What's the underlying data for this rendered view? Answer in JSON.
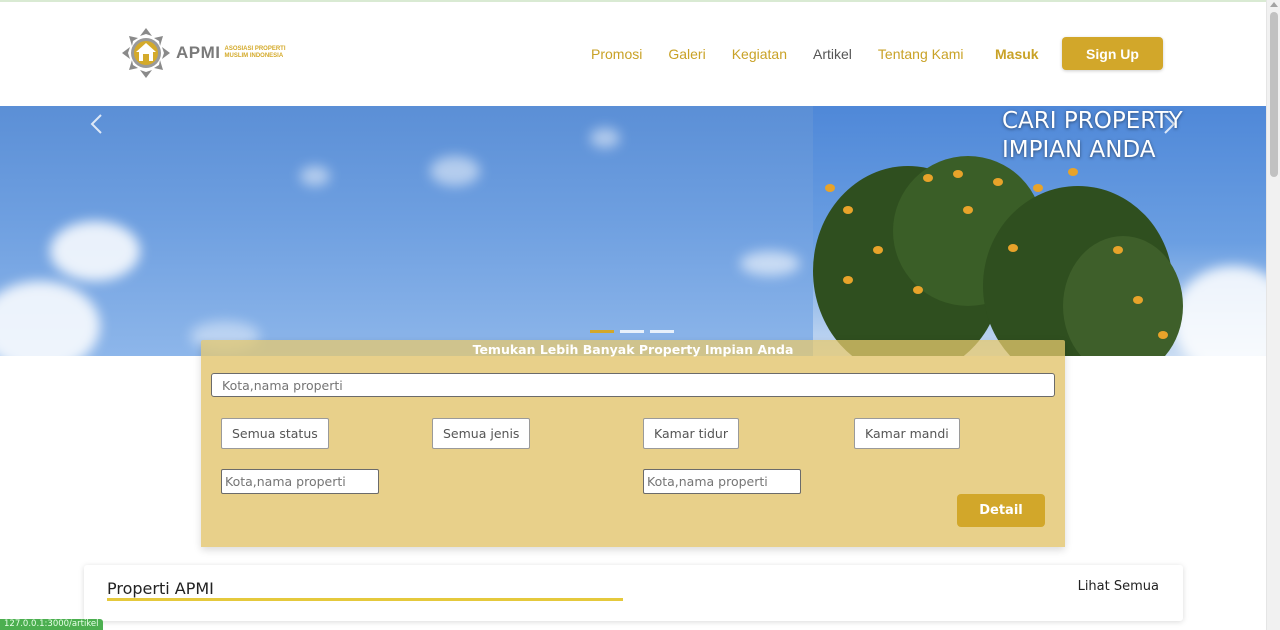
{
  "brand": {
    "name": "APMI",
    "tagline_line1": "ASOSIASI PROPERTI",
    "tagline_line2": "MUSLIM INDONESIA",
    "logo_icon": "house-ornament-icon",
    "accent_color": "#d2a72a"
  },
  "nav": {
    "items": [
      {
        "label": "Promosi",
        "active": false
      },
      {
        "label": "Galeri",
        "active": false
      },
      {
        "label": "Kegiatan",
        "active": false
      },
      {
        "label": "Artikel",
        "active": true
      },
      {
        "label": "Tentang Kami",
        "active": false
      }
    ],
    "login_label": "Masuk",
    "signup_label": "Sign Up"
  },
  "hero": {
    "caption": "CARI PROPERTY IMPIAN ANDA",
    "prev_icon": "chevron-left-icon",
    "next_icon": "chevron-right-icon",
    "active_indicator": 0,
    "indicator_count": 3
  },
  "search": {
    "title": "Temukan Lebih Banyak Property Impian Anda",
    "main_placeholder": "Kota,nama properti",
    "filters": [
      "Semua status",
      "Semua jenis",
      "Kamar tidur",
      "Kamar mandi"
    ],
    "input_left_placeholder": "Kota,nama properti",
    "input_right_placeholder": "Kota,nama properti",
    "detail_label": "Detail"
  },
  "properti": {
    "title": "Properti APMI",
    "see_all": "Lihat Semua"
  },
  "status_bar": {
    "url": "127.0.0.1:3000/artikel"
  }
}
